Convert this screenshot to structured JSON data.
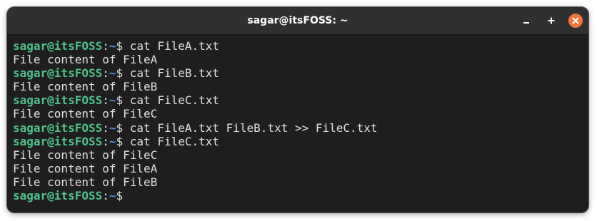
{
  "window": {
    "title": "sagar@itsFOSS: ~",
    "accent_close": "#f2753a",
    "controls": {
      "minimize_icon": "minimize-icon",
      "maximize_icon": "maximize-icon",
      "close_icon": "close-icon"
    }
  },
  "prompt": {
    "user_host": "sagar@itsFOSS",
    "separator": ":",
    "path": "~",
    "symbol": "$ "
  },
  "colors": {
    "background": "#1e1e1e",
    "titlebar": "#303030",
    "prompt_user": "#4fc28c",
    "prompt_path": "#5a8fe0",
    "text": "#e0e0e0"
  },
  "lines": [
    {
      "kind": "cmd",
      "text": "cat FileA.txt"
    },
    {
      "kind": "out",
      "text": "File content of FileA"
    },
    {
      "kind": "cmd",
      "text": "cat FileB.txt"
    },
    {
      "kind": "out",
      "text": "File content of FileB"
    },
    {
      "kind": "cmd",
      "text": "cat FileC.txt"
    },
    {
      "kind": "out",
      "text": "File content of FileC"
    },
    {
      "kind": "cmd",
      "text": "cat FileA.txt FileB.txt >> FileC.txt"
    },
    {
      "kind": "cmd",
      "text": "cat FileC.txt"
    },
    {
      "kind": "out",
      "text": "File content of FileC"
    },
    {
      "kind": "out",
      "text": "File content of FileA"
    },
    {
      "kind": "out",
      "text": "File content of FileB"
    },
    {
      "kind": "cmd",
      "text": ""
    }
  ]
}
